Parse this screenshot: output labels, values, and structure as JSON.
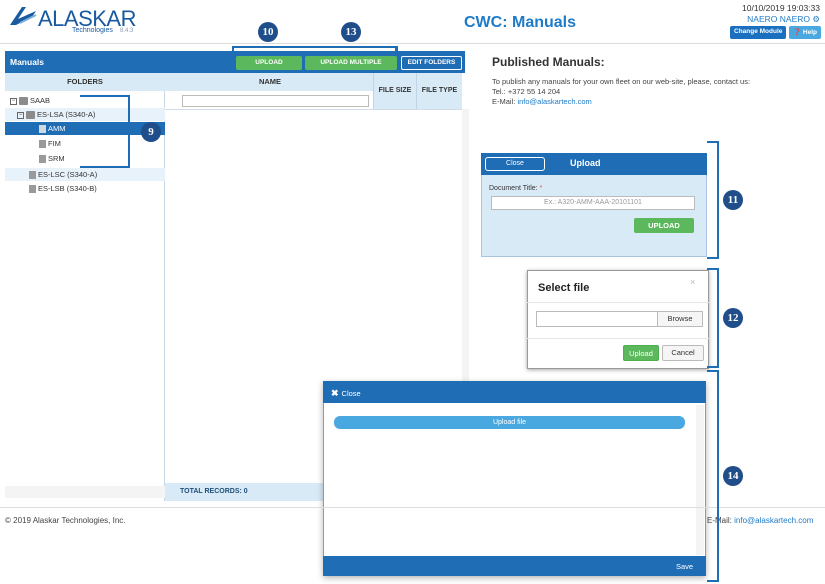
{
  "header": {
    "logo_text": "ALASKAR",
    "logo_sub": "Technologies",
    "version": "8.4.3",
    "page_title": "CWC: Manuals",
    "datetime": "10/10/2019 19:03:33",
    "user": "NAERO NAERO",
    "change_module": "Change Module",
    "help": "Help"
  },
  "toolbar": {
    "section_label": "Manuals",
    "upload": "UPLOAD",
    "upload_multiple": "UPLOAD MULTIPLE",
    "edit_folders": "EDIT FOLDERS"
  },
  "folders": {
    "header": "FOLDERS",
    "items": [
      {
        "label": "SAAB"
      },
      {
        "label": "ES-LSA (S340-A)"
      },
      {
        "label": "AMM"
      },
      {
        "label": "FIM"
      },
      {
        "label": "SRM"
      },
      {
        "label": "ES-LSC (S340-A)"
      },
      {
        "label": "ES-LSB (S340-B)"
      }
    ]
  },
  "grid": {
    "col_name": "NAME",
    "col_size": "FILE SIZE",
    "col_type": "FILE TYPE",
    "total": "TOTAL RECORDS: 0"
  },
  "published": {
    "title": "Published Manuals:",
    "line1": "To publish any manuals for your own fleet on our web-site, please, contact us:",
    "tel": "Tel.: +372 55 14 204",
    "email_label": "E-Mail:",
    "email": "info@alaskartech.com"
  },
  "upload_dialog": {
    "close": "Close",
    "title": "Upload",
    "doc_title_label": "Document Title:",
    "required_mark": "*",
    "placeholder": "Ex.: A320-AMM-AAA-20101101",
    "upload_btn": "UPLOAD"
  },
  "select_file": {
    "title": "Select file",
    "close": "×",
    "browse": "Browse",
    "upload": "Upload",
    "cancel": "Cancel"
  },
  "multi_dialog": {
    "close": "Close",
    "upload_file": "Upload file",
    "save": "Save"
  },
  "footer": {
    "copyright": "© 2019 Alaskar Technologies, Inc.",
    "email_label": "E-Mail:",
    "email": "info@alaskartech.com"
  },
  "callouts": {
    "c9": "9",
    "c10": "10",
    "c11": "11",
    "c12": "12",
    "c13": "13",
    "c14": "14"
  },
  "colors": {
    "primary_blue": "#1f6db5",
    "success_green": "#5cb85c",
    "light_blue": "#d9eaf7",
    "callout_blue": "#1f4e8a"
  }
}
